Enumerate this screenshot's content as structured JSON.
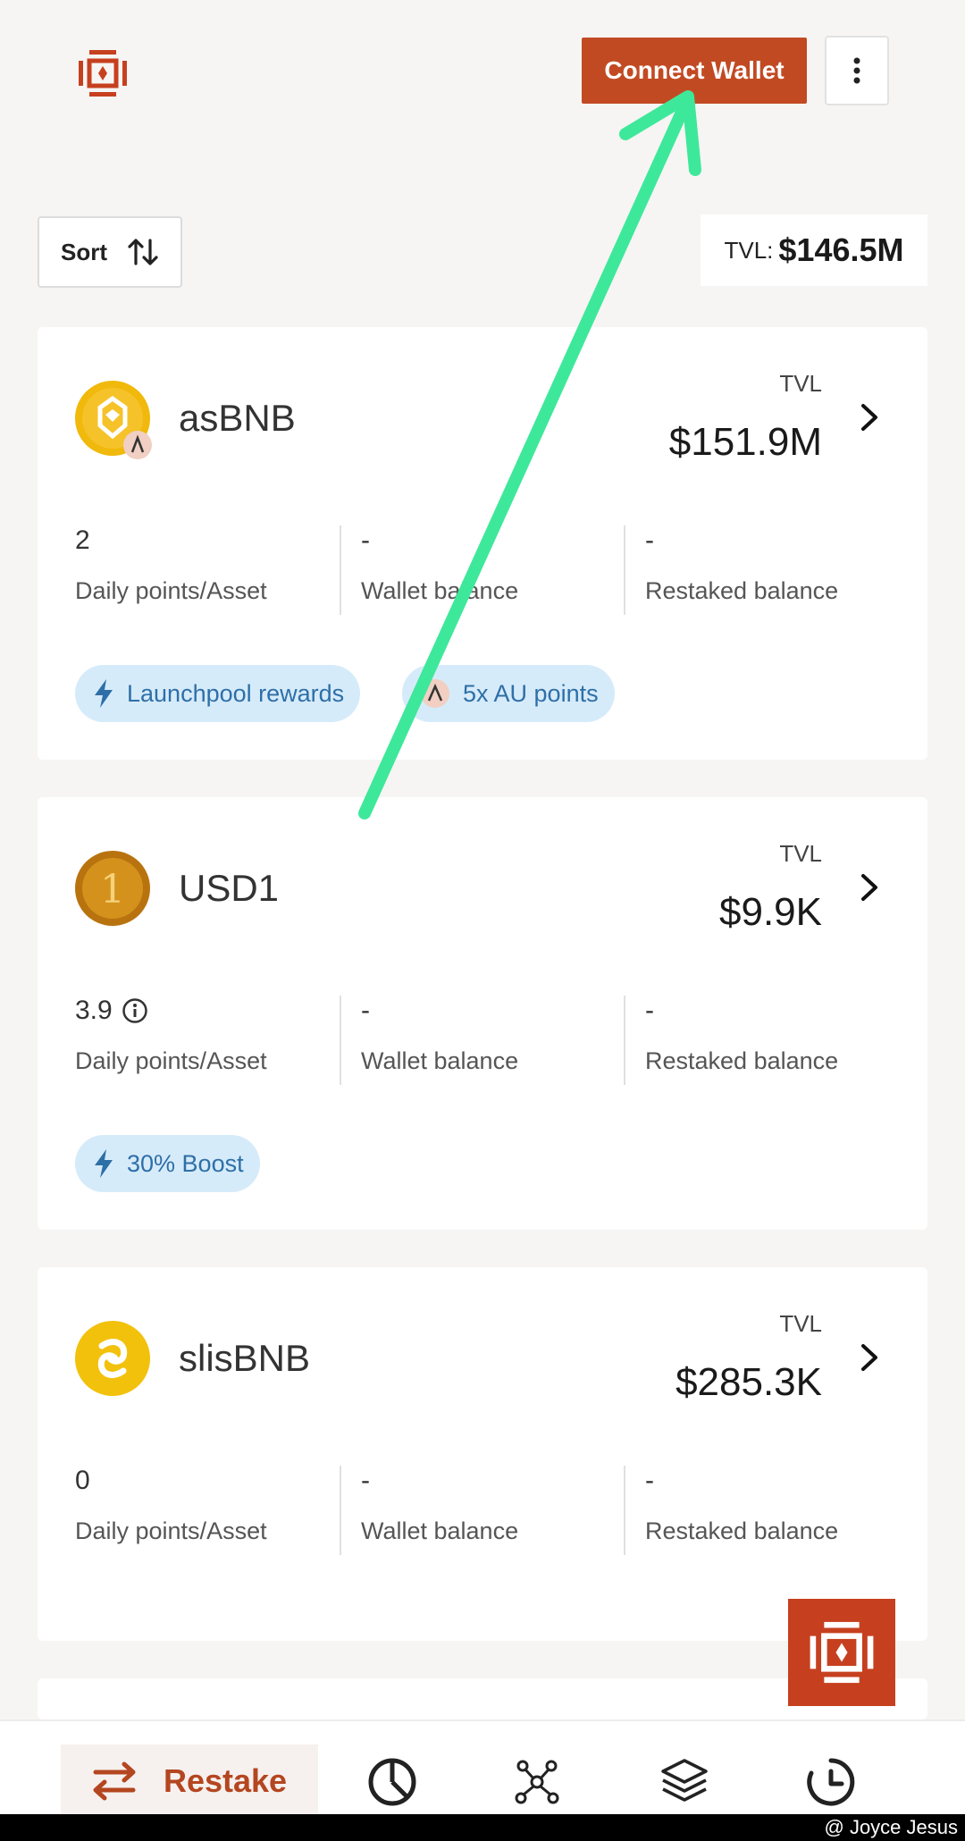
{
  "header": {
    "connect_label": "Connect Wallet",
    "more_icon": "more-vertical-icon",
    "logo_icon": "astherus-logo-icon"
  },
  "toolbar": {
    "sort_label": "Sort",
    "sort_icon": "sort-arrows-icon",
    "tvl_label": "TVL:",
    "tvl_value": "$146.5M"
  },
  "assets": [
    {
      "name": "asBNB",
      "tvl_label": "TVL",
      "tvl_value": "$151.9M",
      "points": "2",
      "points_label": "Daily points/Asset",
      "wallet": "-",
      "wallet_label": "Wallet balance",
      "restaked": "-",
      "restaked_label": "Restaked balance",
      "tags": [
        "Launchpool rewards",
        "5x AU points"
      ]
    },
    {
      "name": "USD1",
      "tvl_label": "TVL",
      "tvl_value": "$9.9K",
      "points": "3.9",
      "points_label": "Daily points/Asset",
      "wallet": "-",
      "wallet_label": "Wallet balance",
      "restaked": "-",
      "restaked_label": "Restaked balance",
      "tags": [
        "30% Boost"
      ]
    },
    {
      "name": "slisBNB",
      "tvl_label": "TVL",
      "tvl_value": "$285.3K",
      "points": "0",
      "points_label": "Daily points/Asset",
      "wallet": "-",
      "wallet_label": "Wallet balance",
      "restaked": "-",
      "restaked_label": "Restaked balance",
      "tags": []
    }
  ],
  "nav": {
    "active_label": "Restake",
    "items": [
      "restake-icon",
      "portfolio-pie-icon",
      "network-nodes-icon",
      "layers-icon",
      "history-clock-icon"
    ]
  },
  "footer": {
    "watermark": "@ Joyce Jesus"
  },
  "colors": {
    "accent": "#c24a23",
    "pill_bg": "#d6ebfa",
    "pill_text": "#2e6fa7",
    "annotation_arrow": "#3ee89a"
  }
}
